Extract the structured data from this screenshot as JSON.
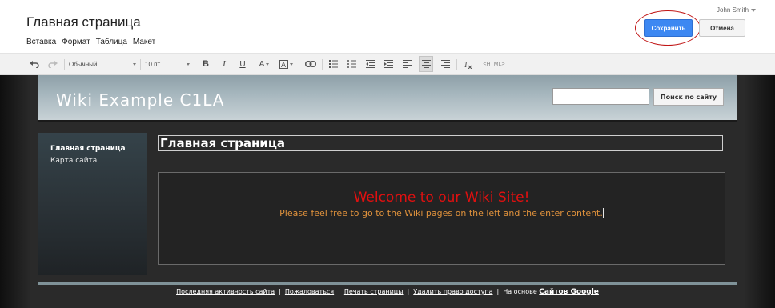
{
  "header": {
    "title": "Главная страница",
    "user": "John Smith",
    "save_label": "Сохранить",
    "cancel_label": "Отмена"
  },
  "menu": [
    "Вставка",
    "Формат",
    "Таблица",
    "Макет"
  ],
  "toolbar": {
    "paragraph_style": "Обычный",
    "font_size": "10 пт",
    "html_label": "<HTML>",
    "icons": [
      "undo-icon",
      "redo-icon",
      "bold-icon",
      "italic-icon",
      "underline-icon",
      "text-color-icon",
      "highlight-color-icon",
      "link-icon",
      "numbered-list-icon",
      "bulleted-list-icon",
      "outdent-icon",
      "indent-icon",
      "align-left-icon",
      "align-center-icon",
      "align-right-icon",
      "clear-formatting-icon"
    ]
  },
  "site": {
    "name": "Wiki Example C1LA",
    "search_button": "Поиск по сайту",
    "sidebar": [
      "Главная страница",
      "Карта сайта"
    ],
    "page_title": "Главная страница",
    "welcome_heading": "Welcome to our Wiki Site!",
    "welcome_text": "Please feel free to go to the Wiki pages on the left and the enter content."
  },
  "footer": {
    "links": [
      "Последняя активность сайта",
      "Пожаловаться",
      "Печать страницы",
      "Удалить право доступа"
    ],
    "powered_prefix": "На основе",
    "powered_link": "Сайтов Google"
  },
  "colors": {
    "save_button": "#3d88f2",
    "highlight_ring": "#c01515",
    "welcome_heading": "#e01010",
    "welcome_text": "#e0923c"
  }
}
